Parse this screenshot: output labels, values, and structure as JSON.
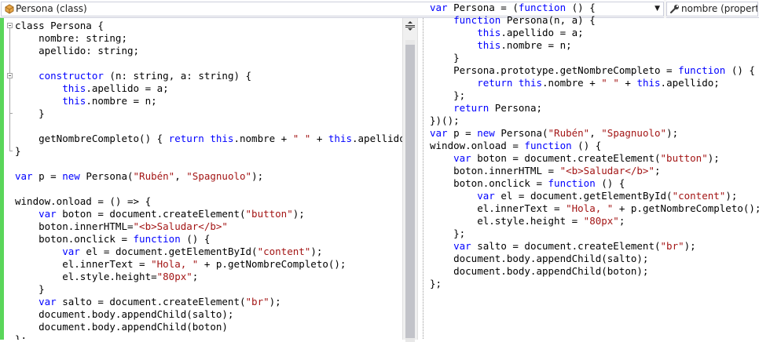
{
  "navbar": {
    "type_selector": "Persona (class)",
    "member_selector": "nombre (property)",
    "type_icon": "class-icon",
    "member_icon": "wrench-icon"
  },
  "colors": {
    "keyword": "#0000ff",
    "string": "#a31515",
    "text": "#000000",
    "changed_line_marker": "#5ad65a"
  },
  "left_code": [
    [
      [
        "t",
        "class Persona {"
      ]
    ],
    [
      [
        "t",
        "    nombre: string;"
      ]
    ],
    [
      [
        "t",
        "    apellido: string;"
      ]
    ],
    [
      [
        "t",
        ""
      ]
    ],
    [
      [
        "t",
        "    "
      ],
      [
        "k",
        "constructor"
      ],
      [
        "t",
        " (n: string, a: string) {"
      ]
    ],
    [
      [
        "t",
        "        "
      ],
      [
        "k",
        "this"
      ],
      [
        "t",
        ".apellido = a;"
      ]
    ],
    [
      [
        "t",
        "        "
      ],
      [
        "k",
        "this"
      ],
      [
        "t",
        ".nombre = n;"
      ]
    ],
    [
      [
        "t",
        "    }"
      ]
    ],
    [
      [
        "t",
        ""
      ]
    ],
    [
      [
        "t",
        "    getNombreCompleto() { "
      ],
      [
        "k",
        "return"
      ],
      [
        "t",
        " "
      ],
      [
        "k",
        "this"
      ],
      [
        "t",
        ".nombre + "
      ],
      [
        "s",
        "\" \""
      ],
      [
        "t",
        " + "
      ],
      [
        "k",
        "this"
      ],
      [
        "t",
        ".apellido };"
      ]
    ],
    [
      [
        "t",
        "}"
      ]
    ],
    [
      [
        "t",
        ""
      ]
    ],
    [
      [
        "k",
        "var"
      ],
      [
        "t",
        " p = "
      ],
      [
        "k",
        "new"
      ],
      [
        "t",
        " Persona("
      ],
      [
        "s",
        "\"Rubén\""
      ],
      [
        "t",
        ", "
      ],
      [
        "s",
        "\"Spagnuolo\""
      ],
      [
        "t",
        ");"
      ]
    ],
    [
      [
        "t",
        ""
      ]
    ],
    [
      [
        "t",
        "window.onload = () => {"
      ]
    ],
    [
      [
        "t",
        "    "
      ],
      [
        "k",
        "var"
      ],
      [
        "t",
        " boton = document.createElement("
      ],
      [
        "s",
        "\"button\""
      ],
      [
        "t",
        ");"
      ]
    ],
    [
      [
        "t",
        "    boton.innerHTML="
      ],
      [
        "s",
        "\"<b>Saludar</b>\""
      ]
    ],
    [
      [
        "t",
        "    boton.onclick = "
      ],
      [
        "k",
        "function"
      ],
      [
        "t",
        " () {"
      ]
    ],
    [
      [
        "t",
        "        "
      ],
      [
        "k",
        "var"
      ],
      [
        "t",
        " el = document.getElementById("
      ],
      [
        "s",
        "\"content\""
      ],
      [
        "t",
        ");"
      ]
    ],
    [
      [
        "t",
        "        el.innerText = "
      ],
      [
        "s",
        "\"Hola, \""
      ],
      [
        "t",
        " + p.getNombreCompleto();"
      ]
    ],
    [
      [
        "t",
        "        el.style.height="
      ],
      [
        "s",
        "\"80px\""
      ],
      [
        "t",
        ";"
      ]
    ],
    [
      [
        "t",
        "    }"
      ]
    ],
    [
      [
        "t",
        "    "
      ],
      [
        "k",
        "var"
      ],
      [
        "t",
        " salto = document.createElement("
      ],
      [
        "s",
        "\"br\""
      ],
      [
        "t",
        ");"
      ]
    ],
    [
      [
        "t",
        "    document.body.appendChild(salto);"
      ]
    ],
    [
      [
        "t",
        "    document.body.appendChild(boton)"
      ]
    ],
    [
      [
        "t",
        "};"
      ]
    ]
  ],
  "right_code": [
    [
      [
        "k",
        "var"
      ],
      [
        "t",
        " Persona = ("
      ],
      [
        "k",
        "function"
      ],
      [
        "t",
        " () {"
      ]
    ],
    [
      [
        "t",
        "    "
      ],
      [
        "k",
        "function"
      ],
      [
        "t",
        " Persona(n, a) {"
      ]
    ],
    [
      [
        "t",
        "        "
      ],
      [
        "k",
        "this"
      ],
      [
        "t",
        ".apellido = a;"
      ]
    ],
    [
      [
        "t",
        "        "
      ],
      [
        "k",
        "this"
      ],
      [
        "t",
        ".nombre = n;"
      ]
    ],
    [
      [
        "t",
        "    }"
      ]
    ],
    [
      [
        "t",
        "    Persona.prototype.getNombreCompleto = "
      ],
      [
        "k",
        "function"
      ],
      [
        "t",
        " () {"
      ]
    ],
    [
      [
        "t",
        "        "
      ],
      [
        "k",
        "return"
      ],
      [
        "t",
        " "
      ],
      [
        "k",
        "this"
      ],
      [
        "t",
        ".nombre + "
      ],
      [
        "s",
        "\" \""
      ],
      [
        "t",
        " + "
      ],
      [
        "k",
        "this"
      ],
      [
        "t",
        ".apellido;"
      ]
    ],
    [
      [
        "t",
        "    };"
      ]
    ],
    [
      [
        "t",
        "    "
      ],
      [
        "k",
        "return"
      ],
      [
        "t",
        " Persona;"
      ]
    ],
    [
      [
        "t",
        "})();"
      ]
    ],
    [
      [
        "k",
        "var"
      ],
      [
        "t",
        " p = "
      ],
      [
        "k",
        "new"
      ],
      [
        "t",
        " Persona("
      ],
      [
        "s",
        "\"Rubén\""
      ],
      [
        "t",
        ", "
      ],
      [
        "s",
        "\"Spagnuolo\""
      ],
      [
        "t",
        ");"
      ]
    ],
    [
      [
        "t",
        "window.onload = "
      ],
      [
        "k",
        "function"
      ],
      [
        "t",
        " () {"
      ]
    ],
    [
      [
        "t",
        "    "
      ],
      [
        "k",
        "var"
      ],
      [
        "t",
        " boton = document.createElement("
      ],
      [
        "s",
        "\"button\""
      ],
      [
        "t",
        ");"
      ]
    ],
    [
      [
        "t",
        "    boton.innerHTML = "
      ],
      [
        "s",
        "\"<b>Saludar</b>\""
      ],
      [
        "t",
        ";"
      ]
    ],
    [
      [
        "t",
        "    boton.onclick = "
      ],
      [
        "k",
        "function"
      ],
      [
        "t",
        " () {"
      ]
    ],
    [
      [
        "t",
        "        "
      ],
      [
        "k",
        "var"
      ],
      [
        "t",
        " el = document.getElementById("
      ],
      [
        "s",
        "\"content\""
      ],
      [
        "t",
        ");"
      ]
    ],
    [
      [
        "t",
        "        el.innerText = "
      ],
      [
        "s",
        "\"Hola, \""
      ],
      [
        "t",
        " + p.getNombreCompleto();"
      ]
    ],
    [
      [
        "t",
        "        el.style.height = "
      ],
      [
        "s",
        "\"80px\""
      ],
      [
        "t",
        ";"
      ]
    ],
    [
      [
        "t",
        "    };"
      ]
    ],
    [
      [
        "t",
        "    "
      ],
      [
        "k",
        "var"
      ],
      [
        "t",
        " salto = document.createElement("
      ],
      [
        "s",
        "\"br\""
      ],
      [
        "t",
        ");"
      ]
    ],
    [
      [
        "t",
        "    document.body.appendChild(salto);"
      ]
    ],
    [
      [
        "t",
        "    document.body.appendChild(boton);"
      ]
    ],
    [
      [
        "t",
        "};"
      ]
    ]
  ]
}
